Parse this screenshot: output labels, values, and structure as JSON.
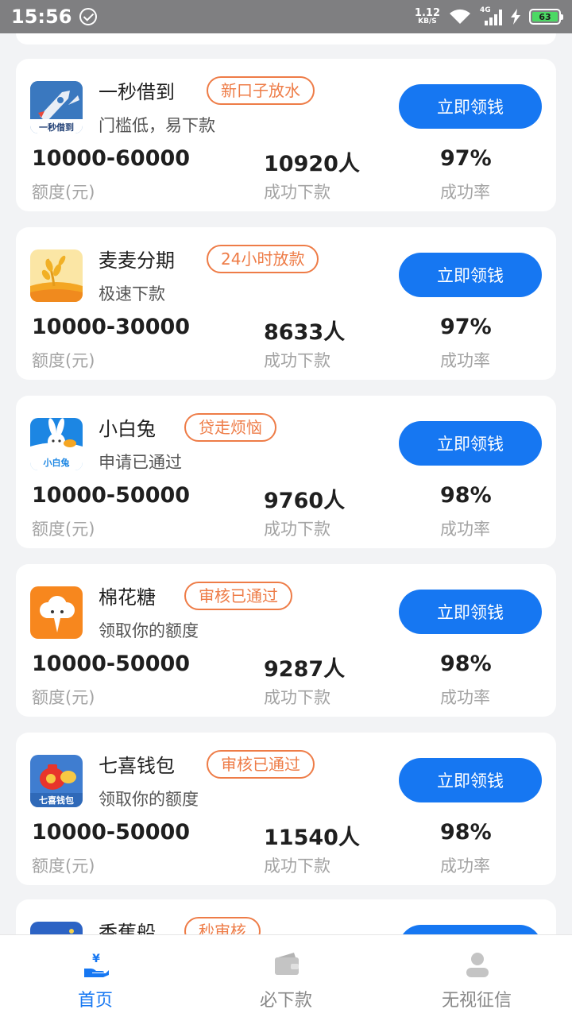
{
  "status_bar": {
    "time": "15:56",
    "net_speed_value": "1.12",
    "net_speed_unit": "KB/S",
    "network_type": "4G",
    "battery": "63"
  },
  "colors": {
    "accent": "#1677f2",
    "tag": "#ee7c47",
    "background": "#f2f3f5"
  },
  "cards": [
    {
      "name": "一秒借到",
      "tag": "新口子放水",
      "desc": "门槛低，易下款",
      "cta": "立即领钱",
      "amount": "10000-60000",
      "amount_label": "额度(元)",
      "count": "10920人",
      "count_label": "成功下款",
      "rate": "97%",
      "rate_label": "成功率",
      "logo_text": "一秒借到",
      "logo_icon": "rocket-icon"
    },
    {
      "name": "麦麦分期",
      "tag": "24小时放款",
      "desc": "极速下款",
      "cta": "立即领钱",
      "amount": "10000-30000",
      "amount_label": "额度(元)",
      "count": "8633人",
      "count_label": "成功下款",
      "rate": "97%",
      "rate_label": "成功率",
      "logo_icon": "wheat-icon"
    },
    {
      "name": "小白兔",
      "tag": "贷走烦恼",
      "desc": "申请已通过",
      "cta": "立即领钱",
      "amount": "10000-50000",
      "amount_label": "额度(元)",
      "count": "9760人",
      "count_label": "成功下款",
      "rate": "98%",
      "rate_label": "成功率",
      "logo_text": "小白兔",
      "logo_icon": "rabbit-icon"
    },
    {
      "name": "棉花糖",
      "tag": "审核已通过",
      "desc": "领取你的额度",
      "cta": "立即领钱",
      "amount": "10000-50000",
      "amount_label": "额度(元)",
      "count": "9287人",
      "count_label": "成功下款",
      "rate": "98%",
      "rate_label": "成功率",
      "logo_icon": "cloud-mascot-icon"
    },
    {
      "name": "七喜钱包",
      "tag": "审核已通过",
      "desc": "领取你的额度",
      "cta": "立即领钱",
      "amount": "10000-50000",
      "amount_label": "额度(元)",
      "count": "11540人",
      "count_label": "成功下款",
      "rate": "98%",
      "rate_label": "成功率",
      "logo_text": "七喜钱包",
      "logo_icon": "money-bag-icon"
    },
    {
      "name": "香蕉船",
      "tag": "秒审核",
      "logo_icon": "banana-boat-icon"
    }
  ],
  "tab_bar": {
    "tabs": [
      {
        "label": "首页",
        "icon": "hand-money-icon",
        "active": true
      },
      {
        "label": "必下款",
        "icon": "wallet-icon",
        "active": false
      },
      {
        "label": "无视征信",
        "icon": "user-icon",
        "active": false
      }
    ]
  }
}
